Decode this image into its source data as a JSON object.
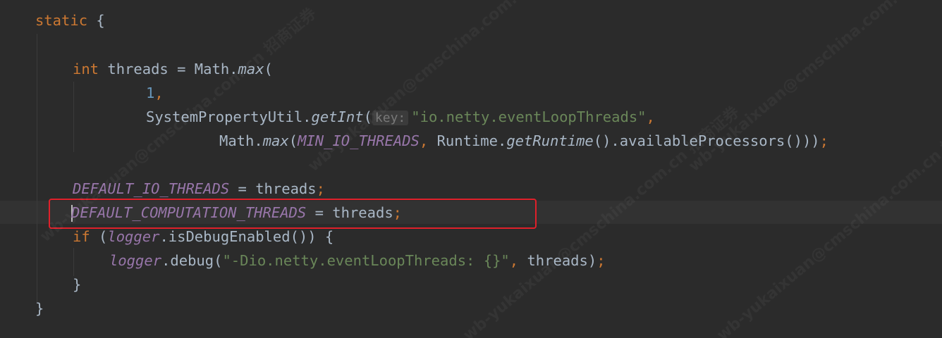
{
  "code": {
    "line1": {
      "kw": "static",
      "rest": " {"
    },
    "line2": {
      "kw": "int",
      "a": " threads = Math.",
      "method": "max",
      "b": "("
    },
    "line3": {
      "num": "1",
      "comma": ","
    },
    "line4": {
      "a": "SystemPropertyUtil.",
      "method": "getInt",
      "paren": "(",
      "hint": "key:",
      "str": "\"io.netty.eventLoopThreads\"",
      "comma": ","
    },
    "line5": {
      "a": "Math.",
      "method": "max",
      "paren": "(",
      "field": "MIN_IO_THREADS",
      "comma": ",",
      "b": " Runtime.",
      "method2": "getRuntime",
      "c": "().availableProcessors()))",
      "semi": ";"
    },
    "line6": {
      "field": "DEFAULT_IO_THREADS",
      "a": " = threads",
      "semi": ";"
    },
    "line7": {
      "field": "DEFAULT_COMPUTATION_THREADS",
      "a": " = threads",
      "semi": ";"
    },
    "line8": {
      "kw": "if",
      "a": " (",
      "field": "logger",
      "b": ".isDebugEnabled()) {"
    },
    "line9": {
      "field": "logger",
      "a": ".debug(",
      "str": "\"-Dio.netty.eventLoopThreads: {}\"",
      "comma": ",",
      "b": " threads)",
      "semi": ";"
    },
    "line10": {
      "a": "}"
    },
    "line11": {
      "a": "}"
    }
  },
  "watermark_text": "wb-yukaixuan@cmschina.com.cn 招商证券"
}
